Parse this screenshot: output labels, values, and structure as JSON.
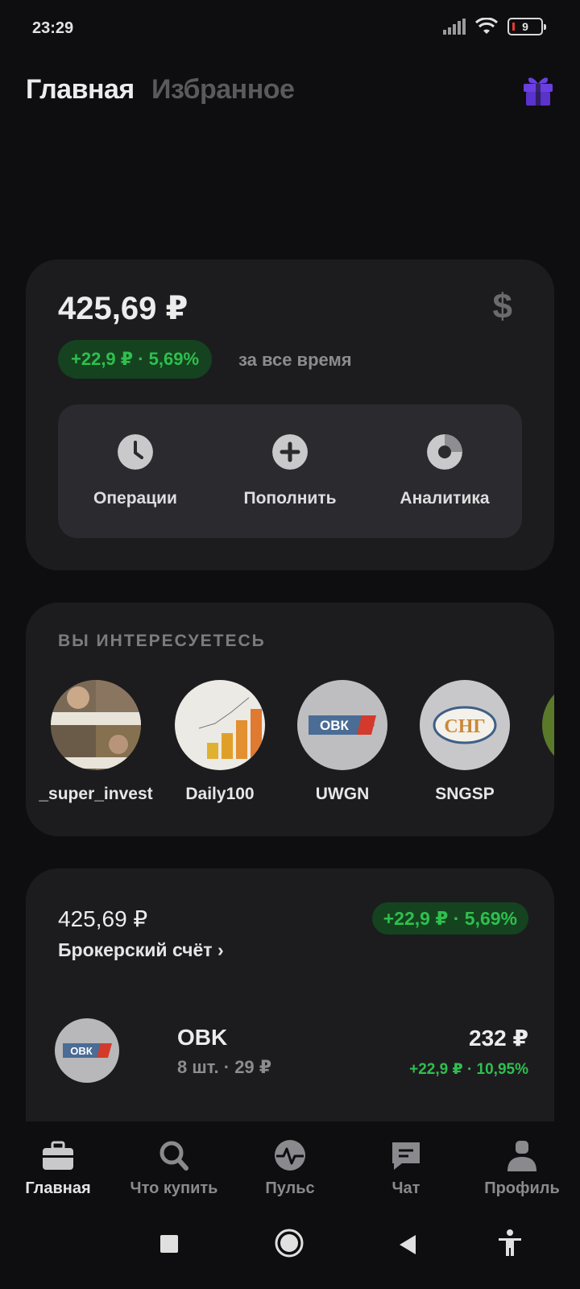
{
  "status": {
    "time": "23:29",
    "battery": "9"
  },
  "header": {
    "tab_main": "Главная",
    "tab_favorites": "Избранное",
    "gift_icon": "gift-icon"
  },
  "balance": {
    "amount": "425,69 ₽",
    "currency_icon": "$",
    "gain": "+22,9 ₽ · 5,69%",
    "gain_caption": "за все время",
    "actions": [
      {
        "label": "Операции",
        "icon": "clock-icon"
      },
      {
        "label": "Пополнить",
        "icon": "plus-icon"
      },
      {
        "label": "Аналитика",
        "icon": "donut-chart-icon"
      }
    ]
  },
  "interests": {
    "title": "ВЫ ИНТЕРЕСУЕТЕСЬ",
    "items": [
      {
        "label": "_super_invest"
      },
      {
        "label": "Daily100"
      },
      {
        "label": "UWGN"
      },
      {
        "label": "SNGSP"
      }
    ],
    "logo_ovk": "ОВК",
    "logo_sng": "СНГ"
  },
  "account": {
    "amount": "425,69 ₽",
    "name": "Брокерский счёт ›",
    "gain": "+22,9 ₽ · 5,69%",
    "positions": [
      {
        "ticker": "OBK",
        "qty": "8 шт. · 29 ₽",
        "value": "232 ₽",
        "change": "+22,9 ₽ · 10,95%",
        "logo": "ОВК"
      }
    ]
  },
  "nav": {
    "items": [
      {
        "label": "Главная",
        "icon": "briefcase-icon"
      },
      {
        "label": "Что купить",
        "icon": "search-icon"
      },
      {
        "label": "Пульс",
        "icon": "pulse-icon"
      },
      {
        "label": "Чат",
        "icon": "chat-icon"
      },
      {
        "label": "Профиль",
        "icon": "profile-icon"
      }
    ]
  },
  "colors": {
    "accent_green": "#2fbf4e",
    "gift_purple": "#6a3fe0"
  }
}
